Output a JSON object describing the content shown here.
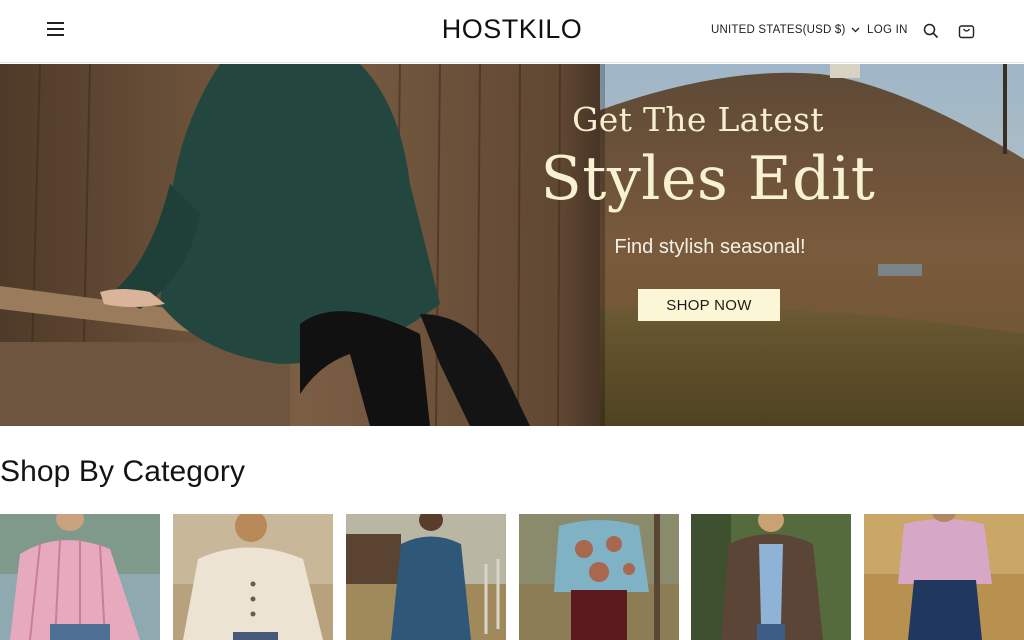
{
  "header": {
    "logo": "HOSTKILO",
    "currency": "UNITED STATES(USD $)",
    "login": "LOG IN",
    "icons": [
      "menu-icon",
      "chevron-down-icon",
      "search-icon",
      "cart-icon"
    ]
  },
  "hero": {
    "title_line1": "Get The Latest",
    "title_line2": "Styles Edit",
    "subtitle": "Find stylish seasonal!",
    "cta": "SHOP NOW"
  },
  "categories": {
    "heading": "Shop By Category",
    "count_visible": 6
  },
  "colors": {
    "hero_text": "#f9f2d2",
    "cta_bg": "#fbf6d6",
    "text": "#111111"
  }
}
